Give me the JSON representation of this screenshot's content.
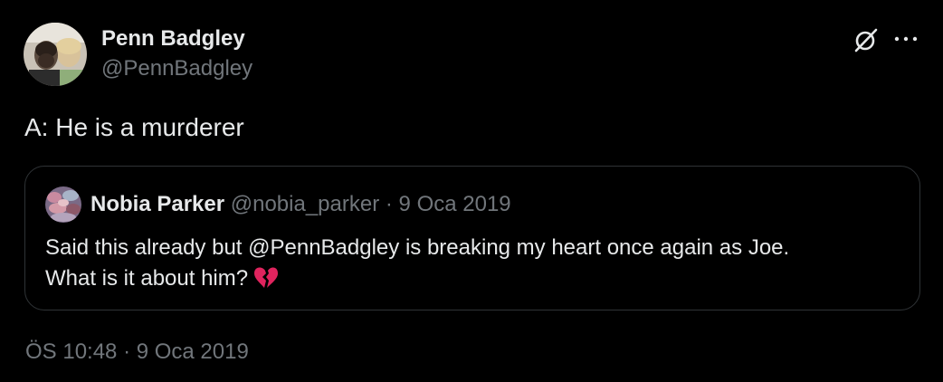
{
  "author": {
    "name": "Penn Badgley",
    "handle": "@PennBadgley",
    "avatar_icon": "user-photo-avatar"
  },
  "actions": {
    "grok_icon": "grok-icon",
    "more_icon": "more-horizontal-icon"
  },
  "tweet": {
    "text": "A: He is a murderer",
    "timestamp": "ÖS 10:48 · 9 Oca 2019"
  },
  "quoted_tweet": {
    "author_name": "Nobia Parker",
    "author_handle": "@nobia_parker",
    "separator": " · ",
    "date": "9 Oca 2019",
    "text_line1": "Said this already but @PennBadgley is breaking my heart once again as Joe.",
    "text_line2": "What is it about him?",
    "emoji_icon": "broken-heart-icon",
    "avatar_icon": "user-photo-avatar"
  },
  "colors": {
    "background": "#000000",
    "primary_text": "#e7e9ea",
    "secondary_text": "#71767b",
    "border": "#2f3336",
    "broken_heart": "#e0245e"
  }
}
